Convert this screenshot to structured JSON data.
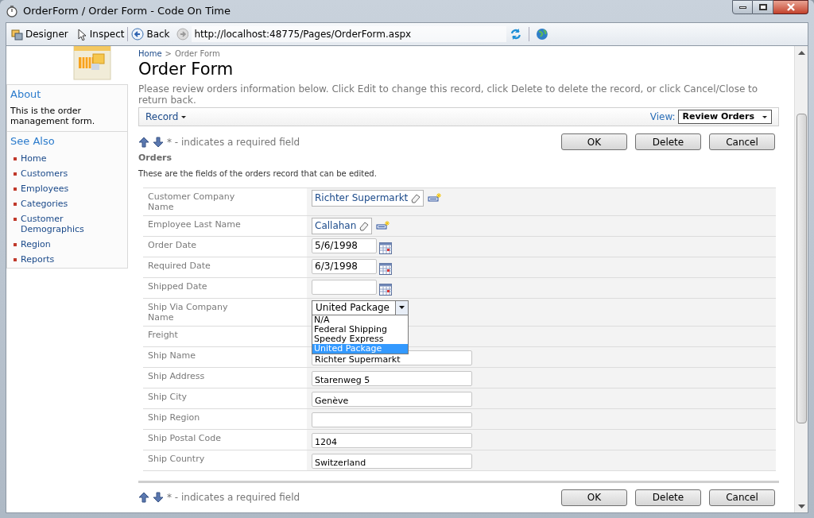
{
  "window": {
    "title": "OrderForm / Order Form - Code On Time"
  },
  "toolbar": {
    "tools": [
      "Designer",
      "Inspect"
    ],
    "back": "Back",
    "url": "http://localhost:48775/Pages/OrderForm.aspx"
  },
  "breadcrumb": [
    {
      "label": "Home",
      "kind": "link"
    },
    {
      "label": ">",
      "kind": "separator"
    },
    {
      "label": "Order Form",
      "kind": "current"
    }
  ],
  "page_title": "Order Form",
  "sidebar": {
    "about": {
      "title": "About",
      "text": "This is the order management form."
    },
    "see_also": {
      "title": "See Also",
      "items": [
        "Home",
        "Customers",
        "Employees",
        "Categories",
        "Customer Demographics",
        "Region",
        "Reports"
      ]
    }
  },
  "description": "Please review orders information below. Click Edit to change this record, click Delete to delete the record, or click Cancel/Close to return back.",
  "action_bar": {
    "menu": "Record",
    "view_label": "View:",
    "view_value": "Review Orders"
  },
  "top_actions": {
    "note": "* - indicates a required field",
    "buttons": [
      "OK",
      "Delete",
      "Cancel"
    ]
  },
  "section": {
    "title": "Orders",
    "description": "These are the fields of the orders record that can be edited."
  },
  "fields": [
    {
      "label": "Customer Company Name",
      "kind": "lookup",
      "value": "Richter Supermarkt"
    },
    {
      "label": "Employee Last Name",
      "kind": "lookup",
      "value": "Callahan"
    },
    {
      "label": "Order Date",
      "kind": "date",
      "value": "5/6/1998"
    },
    {
      "label": "Required Date",
      "kind": "date",
      "value": "6/3/1998"
    },
    {
      "label": "Shipped Date",
      "kind": "date"
    },
    {
      "label": "Ship Via Company Name",
      "kind": "dropdown",
      "value": "United Package",
      "expanded": true,
      "options": [
        {
          "label": "N/A",
          "selected": false
        },
        {
          "label": "Federal Shipping",
          "selected": false
        },
        {
          "label": "Speedy Express",
          "selected": false
        },
        {
          "label": "United Package",
          "selected": true
        }
      ]
    },
    {
      "label": "Freight",
      "kind": "hidden"
    },
    {
      "label": "Ship Name",
      "kind": "text",
      "value": "Richter Supermarkt"
    },
    {
      "label": "Ship Address",
      "kind": "text",
      "value": "Starenweg 5"
    },
    {
      "label": "Ship City",
      "kind": "text",
      "value": "Genève"
    },
    {
      "label": "Ship Region",
      "kind": "text"
    },
    {
      "label": "Ship Postal Code",
      "kind": "text",
      "value": "1204"
    },
    {
      "label": "Ship Country",
      "kind": "text",
      "value": "Switzerland"
    }
  ],
  "bottom_actions": {
    "note": "* - indicates a required field",
    "buttons": [
      "OK",
      "Delete",
      "Cancel"
    ]
  }
}
